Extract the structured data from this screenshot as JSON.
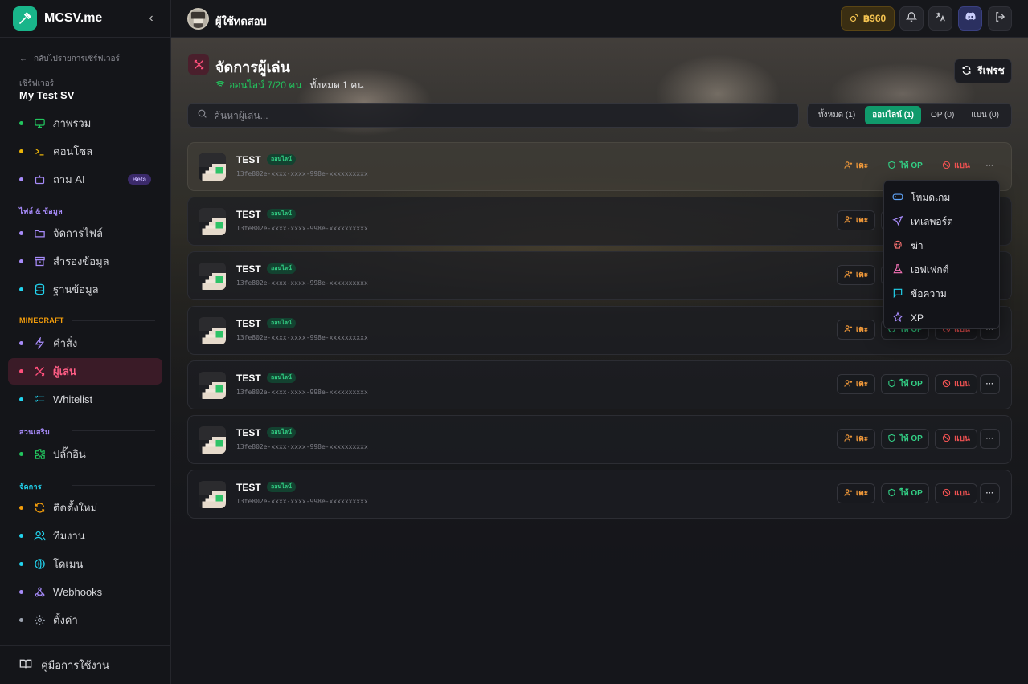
{
  "brand": {
    "name": "MCSV.me"
  },
  "sidebar": {
    "back_label": "กลับไปรายการเซิร์ฟเวอร์",
    "server_caption": "เซิร์ฟเวอร์",
    "server_name": "My Test SV",
    "items": [
      {
        "label": "ภาพรวม",
        "icon": "monitor-icon",
        "dot": "#22c55e"
      },
      {
        "label": "คอนโซล",
        "icon": "terminal-icon",
        "dot": "#eab308"
      },
      {
        "label": "ถาม AI",
        "icon": "bot-icon",
        "dot": "#a78bfa",
        "badge": "Beta"
      },
      {
        "label": "จัดการไฟล์",
        "icon": "folder-icon",
        "dot": "#a78bfa"
      },
      {
        "label": "สำรองข้อมูล",
        "icon": "archive-icon",
        "dot": "#a78bfa"
      },
      {
        "label": "ฐานข้อมูล",
        "icon": "database-icon",
        "dot": "#22d3ee"
      },
      {
        "label": "คำสั่ง",
        "icon": "zap-icon",
        "dot": "#a78bfa"
      },
      {
        "label": "ผู้เล่น",
        "icon": "swords-icon",
        "dot": "#ff4f7b"
      },
      {
        "label": "Whitelist",
        "icon": "list-checks-icon",
        "dot": "#22d3ee"
      },
      {
        "label": "ปลั๊กอิน",
        "icon": "puzzle-icon",
        "dot": "#22c55e"
      },
      {
        "label": "ติดตั้งใหม่",
        "icon": "refresh-icon",
        "dot": "#f59e0b"
      },
      {
        "label": "ทีมงาน",
        "icon": "users-icon",
        "dot": "#22d3ee"
      },
      {
        "label": "โดเมน",
        "icon": "globe-icon",
        "dot": "#22d3ee"
      },
      {
        "label": "Webhooks",
        "icon": "webhook-icon",
        "dot": "#a78bfa"
      },
      {
        "label": "ตั้งค่า",
        "icon": "settings-icon",
        "dot": "#9ca3af"
      }
    ],
    "sections": {
      "files": "ไฟล์ & ข้อมูล",
      "minecraft": "MINECRAFT",
      "addons": "ส่วนเสริม",
      "manage": "จัดการ"
    },
    "footer_label": "คู่มือการใช้งาน"
  },
  "topbar": {
    "user_name": "ผู้ใช้ทดสอบ",
    "credits": "฿960"
  },
  "page": {
    "title": "จัดการผู้เล่น",
    "online_text": "ออนไลน์ 7/20 คน",
    "total_text": "ทั้งหมด 1 คน",
    "refresh_label": "รีเฟรช",
    "search_placeholder": "ค้นหาผู้เล่น...",
    "filters": [
      "ทั้งหมด (1)",
      "ออนไลน์ (1)",
      "OP (0)",
      "แบน (0)"
    ],
    "active_filter": "ออนไลน์ (1)"
  },
  "players": [
    {
      "name": "TEST",
      "status": "ออนไลน์",
      "uuid": "13fe802e-xxxx-xxxx-998e-xxxxxxxxxx"
    },
    {
      "name": "TEST",
      "status": "ออนไลน์",
      "uuid": "13fe802e-xxxx-xxxx-998e-xxxxxxxxxx"
    },
    {
      "name": "TEST",
      "status": "ออนไลน์",
      "uuid": "13fe802e-xxxx-xxxx-998e-xxxxxxxxxx"
    },
    {
      "name": "TEST",
      "status": "ออนไลน์",
      "uuid": "13fe802e-xxxx-xxxx-998e-xxxxxxxxxx"
    },
    {
      "name": "TEST",
      "status": "ออนไลน์",
      "uuid": "13fe802e-xxxx-xxxx-998e-xxxxxxxxxx"
    },
    {
      "name": "TEST",
      "status": "ออนไลน์",
      "uuid": "13fe802e-xxxx-xxxx-998e-xxxxxxxxxx"
    },
    {
      "name": "TEST",
      "status": "ออนไลน์",
      "uuid": "13fe802e-xxxx-xxxx-998e-xxxxxxxxxx"
    }
  ],
  "row_actions": {
    "kick": "เตะ",
    "op": "ให้ OP",
    "ban": "แบน"
  },
  "context_menu": [
    {
      "label": "โหมดเกม",
      "icon": "gamepad-icon"
    },
    {
      "label": "เทเลพอร์ต",
      "icon": "send-icon"
    },
    {
      "label": "ฆ่า",
      "icon": "skull-icon"
    },
    {
      "label": "เอฟเฟกต์",
      "icon": "flask-icon"
    },
    {
      "label": "ข้อความ",
      "icon": "message-icon"
    },
    {
      "label": "XP",
      "icon": "star-icon"
    }
  ]
}
